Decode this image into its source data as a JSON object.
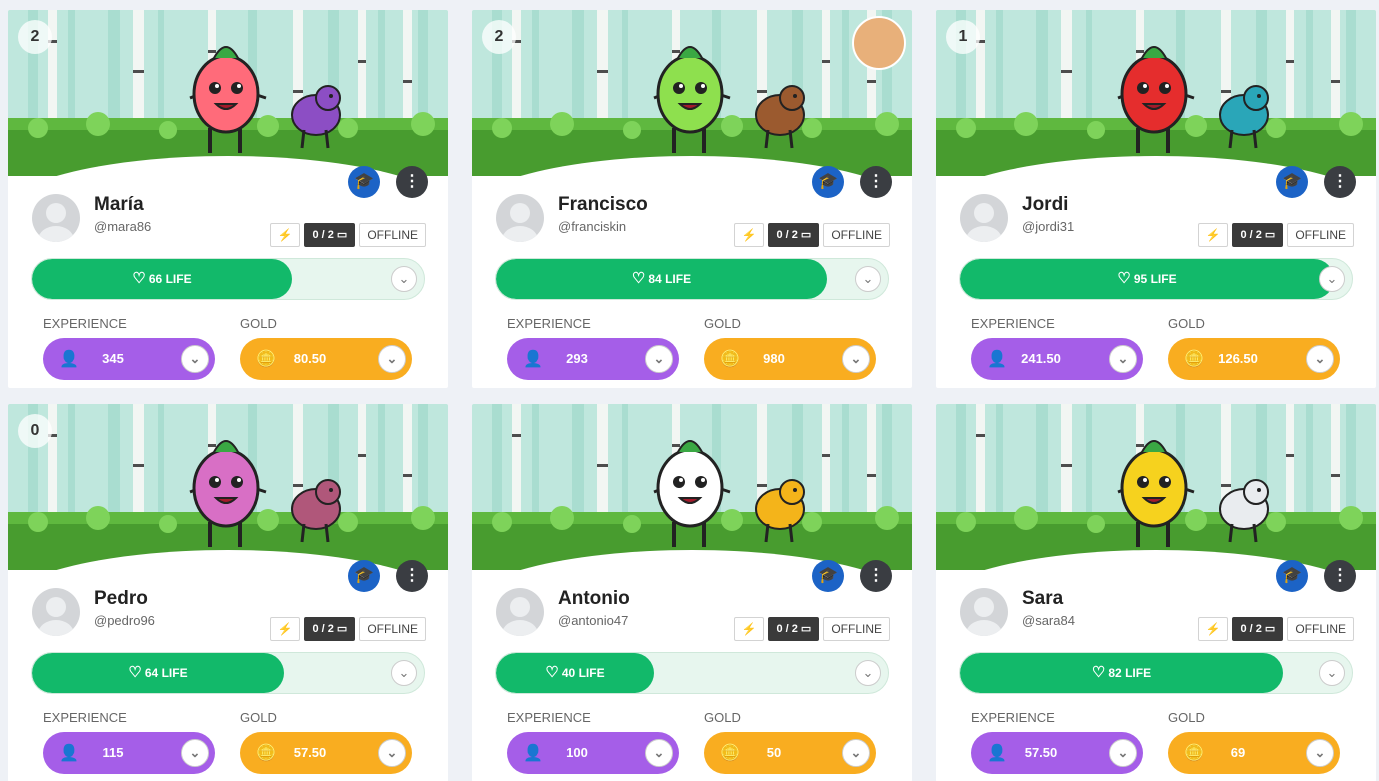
{
  "labels": {
    "experience": "EXPERIENCE",
    "gold": "GOLD",
    "life": "LIFE",
    "offline": "OFFLINE",
    "cards": "0 / 2"
  },
  "colors": {
    "life_fill": "#12b96a",
    "experience": "#a55ee8",
    "gold": "#f9ad20",
    "class_button": "#1c63c6",
    "menu_button": "#3a3d42"
  },
  "icons": {
    "class": "graduation-cap-icon",
    "menu": "vertical-dots-icon",
    "life": "heart-icon",
    "experience": "add-user-icon",
    "gold": "coins-icon",
    "power": "lightning-icon",
    "card": "card-icon",
    "expand": "chevron-down-icon"
  },
  "students": [
    {
      "level": "2",
      "name": "María",
      "username": "@mara86",
      "life": 66,
      "life_text": "66",
      "experience": "345",
      "gold": "80.50",
      "pet_color": "#ff6b7a",
      "companion_color": "#8c4ec4",
      "has_top_avatar": false
    },
    {
      "level": "2",
      "name": "Francisco",
      "username": "@franciskin",
      "life": 84,
      "life_text": "84",
      "experience": "293",
      "gold": "980",
      "pet_color": "#8ee04e",
      "companion_color": "#9b5a2f",
      "has_top_avatar": true
    },
    {
      "level": "1",
      "name": "Jordi",
      "username": "@jordi31",
      "life": 95,
      "life_text": "95",
      "experience": "241.50",
      "gold": "126.50",
      "pet_color": "#e52d2d",
      "companion_color": "#2aa6b8",
      "has_top_avatar": false
    },
    {
      "level": "0",
      "name": "Pedro",
      "username": "@pedro96",
      "life": 64,
      "life_text": "64",
      "experience": "115",
      "gold": "57.50",
      "pet_color": "#d86fc5",
      "companion_color": "#b0577a",
      "has_top_avatar": false
    },
    {
      "level": "",
      "name": "Antonio",
      "username": "@antonio47",
      "life": 40,
      "life_text": "40",
      "experience": "100",
      "gold": "50",
      "pet_color": "#ffffff",
      "companion_color": "#f4b41a",
      "has_top_avatar": false
    },
    {
      "level": "",
      "name": "Sara",
      "username": "@sara84",
      "life": 82,
      "life_text": "82",
      "experience": "57.50",
      "gold": "69",
      "pet_color": "#f6d21e",
      "companion_color": "#e9ecef",
      "has_top_avatar": false
    }
  ]
}
